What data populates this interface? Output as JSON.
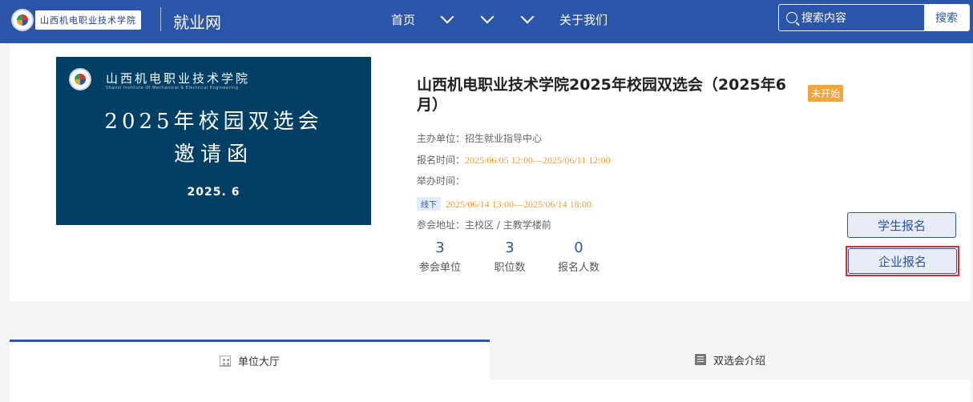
{
  "header": {
    "logo_text": "山西机电职业技术学院",
    "site_name": "就业网",
    "nav": [
      {
        "label": "首页"
      },
      {
        "label": "",
        "chevron": true
      },
      {
        "label": "",
        "chevron": true
      },
      {
        "label": "",
        "chevron": true
      },
      {
        "label": "关于我们"
      }
    ],
    "search": {
      "placeholder": "搜索内容",
      "button_label": "搜索"
    }
  },
  "poster": {
    "school_name": "山西机电职业技术学院",
    "school_name_en": "Shanxi Institute Of Mechanical & Electrical Engineering",
    "title": "2025年校园双选会",
    "subtitle": "邀请函",
    "date": "2025. 6"
  },
  "event": {
    "title": "山西机电职业技术学院2025年校园双选会（2025年6月）",
    "status": "未开始",
    "organizer_label": "主办单位：",
    "organizer": "招生就业指导中心",
    "signup_label": "报名时间：",
    "signup_time": "2025/06/05 12:00—2025/06/11 12:00",
    "hold_label": "举办时间：",
    "mode_tag": "线下",
    "hold_time": "2025/06/14 13:00—2025/06/14 18:00",
    "venue_label": "参会地址：",
    "venue": "主校区 / 主教学楼前"
  },
  "stats": [
    {
      "value": "3",
      "label": "参会单位"
    },
    {
      "value": "3",
      "label": "职位数"
    },
    {
      "value": "0",
      "label": "报名人数"
    }
  ],
  "actions": {
    "student_signup": "学生报名",
    "company_signup": "企业报名"
  },
  "tabs": [
    {
      "label": "单位大厅",
      "icon": "building-icon",
      "active": true
    },
    {
      "label": "双选会介绍",
      "icon": "book-icon",
      "active": false
    }
  ],
  "colors": {
    "primary": "#2b55a8",
    "accent_orange": "#ef9b34",
    "badge_orange": "#f2a53a",
    "highlight_red": "#d32f2f",
    "poster_bg": "#023f64"
  }
}
